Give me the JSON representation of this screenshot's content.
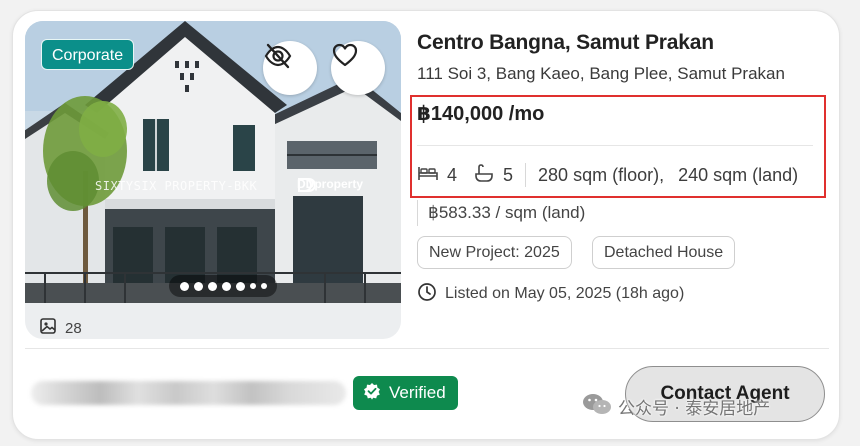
{
  "listing": {
    "badge": "Corporate",
    "photo_count": "28",
    "photo_watermark": "SIXTYSIX PROPERTY-BKK",
    "photo_logo_text": "DDproperty",
    "carousel_dots": 7,
    "carousel_active_index": 0,
    "title": "Centro Bangna, Samut Prakan",
    "address": "111 Soi 3, Bang Kaeo, Bang Plee, Samut Prakan",
    "price": "฿140,000 /mo",
    "bedrooms": "4",
    "bathrooms": "5",
    "floor_area": "280 sqm (floor),",
    "land_area": "240 sqm (land)",
    "price_per_unit": "฿583.33 / sqm (land)",
    "tags": [
      "New Project: 2025",
      "Detached House"
    ],
    "listed_text": "Listed on May 05, 2025 (18h ago)"
  },
  "footer": {
    "verified_label": "Verified",
    "contact_label": "Contact Agent"
  },
  "overlay": {
    "wechat_watermark": "公众号 · 泰安居地产"
  },
  "colors": {
    "corporate_badge": "#0b8f8a",
    "verified_badge": "#0e8a4e",
    "highlight_border": "#e0302e",
    "contact_button_bg": "#e4e4e4"
  },
  "icons": {
    "hide": "eye-slash-icon",
    "favorite": "heart-icon",
    "gallery": "image-icon",
    "bed": "bed-icon",
    "bath": "bathtub-icon",
    "clock": "clock-icon",
    "verified": "badge-check-icon",
    "wechat": "wechat-icon"
  }
}
